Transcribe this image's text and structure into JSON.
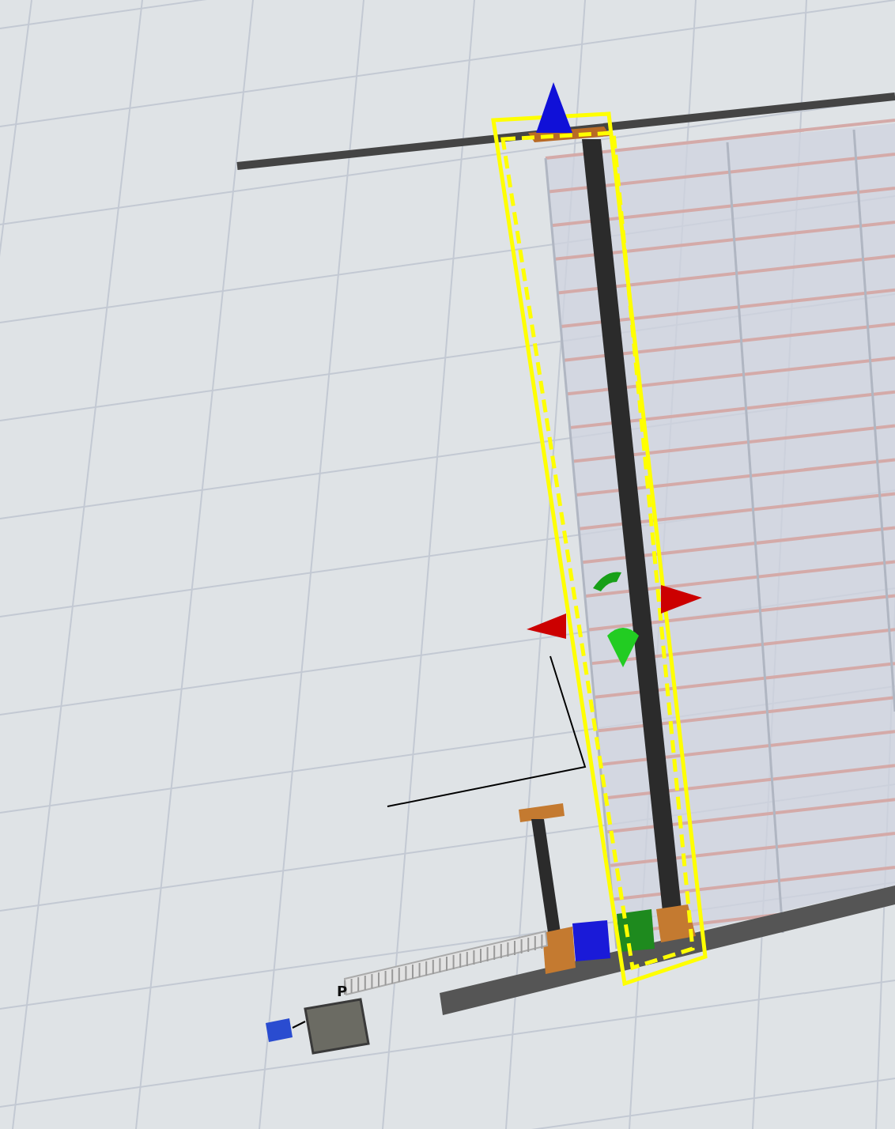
{
  "crane": {
    "selected": true
  },
  "source": {
    "label": "P"
  }
}
